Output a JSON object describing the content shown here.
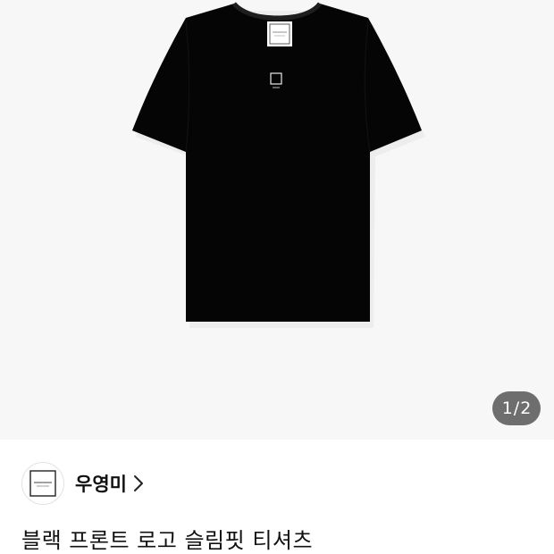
{
  "gallery": {
    "current_page": "1",
    "separator": "/",
    "total_pages": "2",
    "background": "#f7f7f7",
    "garment_color": "#050505"
  },
  "seller": {
    "name": "우영미",
    "avatar_icon": "brand-logo-icon"
  },
  "product": {
    "title": "블랙 프론트 로고 슬림핏 티셔츠"
  },
  "icons": {
    "chevron": "chevron-right-icon"
  }
}
